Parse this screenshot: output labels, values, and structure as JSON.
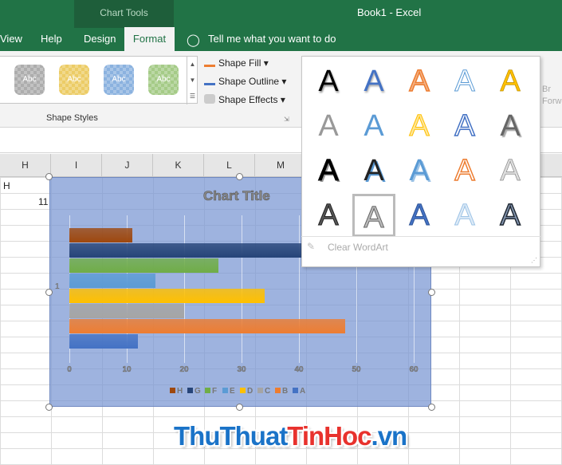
{
  "window": {
    "context_title": "Chart Tools",
    "title": "Book1  -  Excel"
  },
  "tabs": [
    {
      "label": "View"
    },
    {
      "label": "Help"
    },
    {
      "label": "Design"
    },
    {
      "label": "Format",
      "active": true
    }
  ],
  "tell_me": "Tell me what you want to do",
  "ribbon": {
    "shape_styles": [
      "Abc",
      "Abc",
      "Abc",
      "Abc"
    ],
    "shape_fill": "Shape Fill",
    "shape_outline": "Shape Outline",
    "shape_effects": "Shape Effects",
    "group_label": "Shape Styles",
    "partial_right": "Br\nForw"
  },
  "columns": [
    "H",
    "I",
    "J",
    "K",
    "L",
    "M"
  ],
  "cells": {
    "h1": "H",
    "h2": "11"
  },
  "chart_data": {
    "type": "bar",
    "orientation": "horizontal",
    "title": "Chart Title",
    "categories": [
      "1"
    ],
    "series": [
      {
        "name": "H",
        "value": 11,
        "color": "#9e480e"
      },
      {
        "name": "G",
        "value": 45,
        "color": "#264478"
      },
      {
        "name": "F",
        "value": 26,
        "color": "#70ad47"
      },
      {
        "name": "E",
        "value": 15,
        "color": "#5b9bd5"
      },
      {
        "name": "D",
        "value": 34,
        "color": "#ffc000"
      },
      {
        "name": "C",
        "value": 20,
        "color": "#a5a5a5"
      },
      {
        "name": "B",
        "value": 48,
        "color": "#ed7d31"
      },
      {
        "name": "A",
        "value": 12,
        "color": "#4472c4"
      }
    ],
    "xlim": [
      0,
      60
    ],
    "ticks": [
      "0",
      "10",
      "20",
      "30",
      "40",
      "50",
      "60"
    ],
    "grid": true,
    "legend": "bottom"
  },
  "wordart": {
    "glyph": "A",
    "clear_label": "Clear WordArt",
    "selected_index": 16
  },
  "watermark": {
    "part1": "ThuThuat",
    "part2": "TinHoc",
    "part3": ".vn"
  }
}
